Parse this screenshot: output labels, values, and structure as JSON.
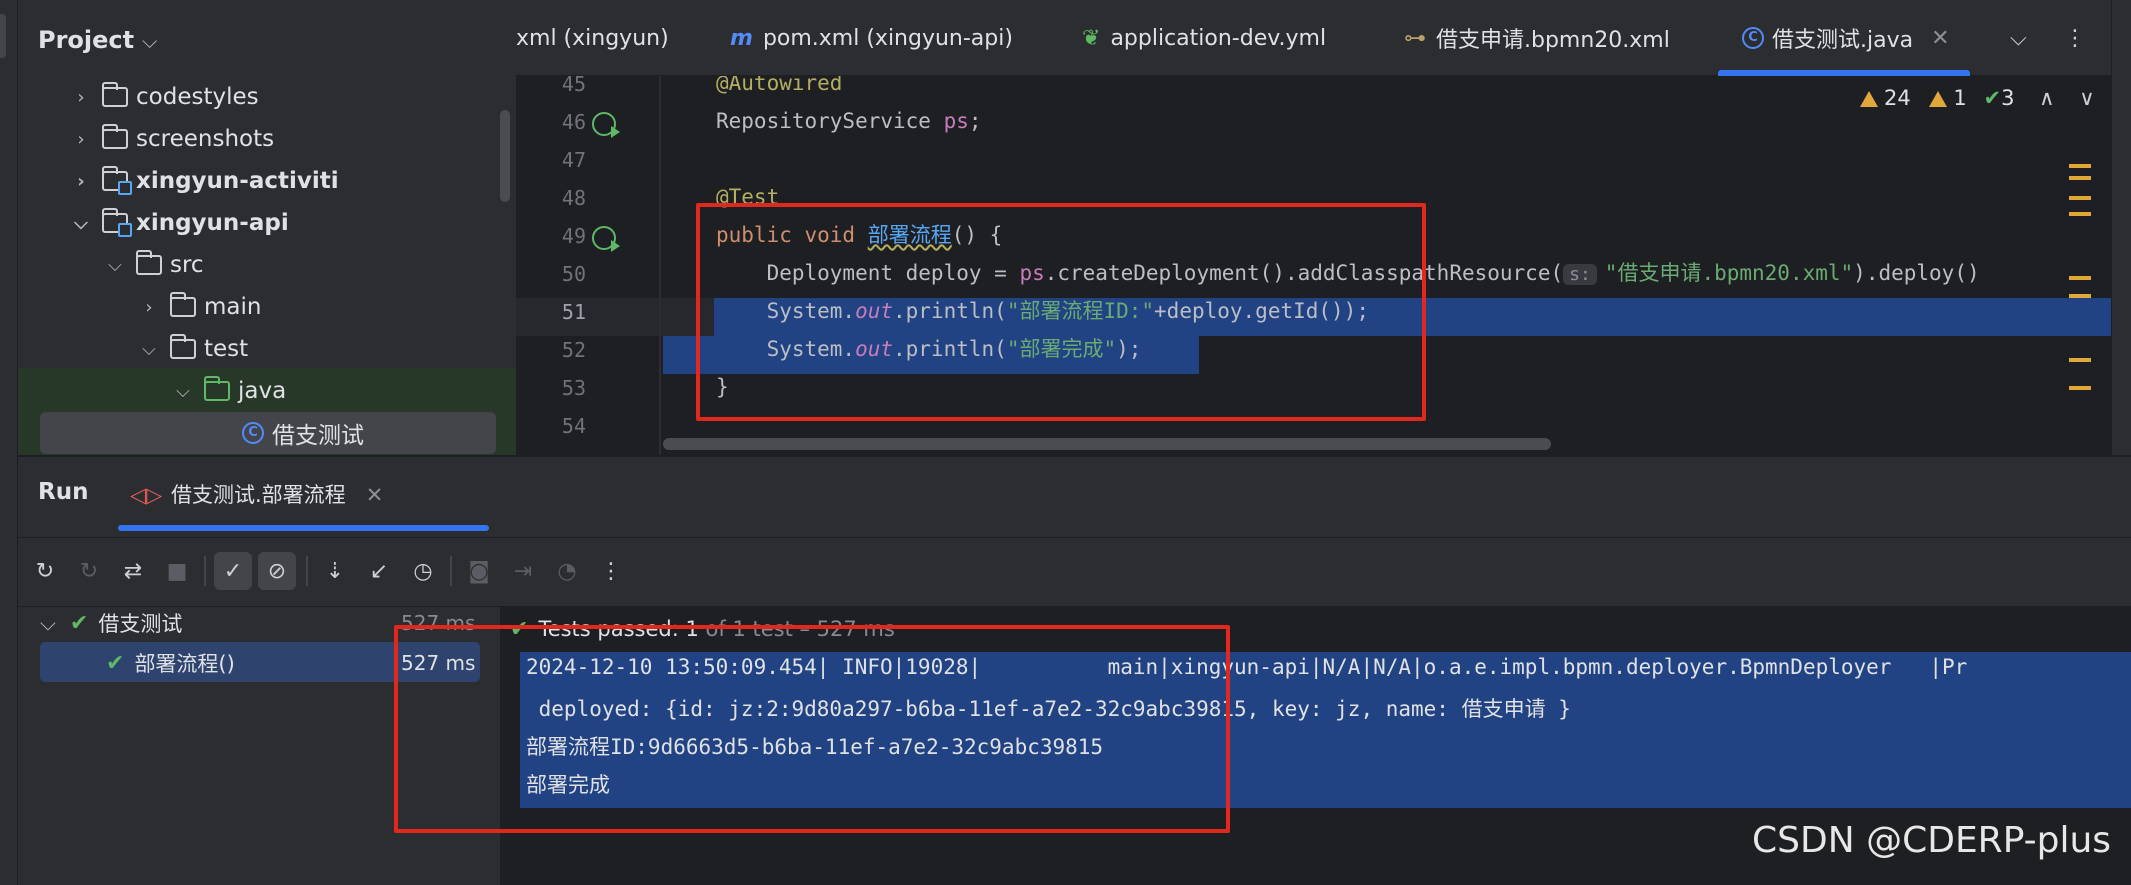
{
  "project": {
    "title": "Project",
    "tree": [
      {
        "label": "codestyles"
      },
      {
        "label": "screenshots"
      },
      {
        "label": "xingyun-activiti"
      },
      {
        "label": "xingyun-api"
      },
      {
        "label": "src"
      },
      {
        "label": "main"
      },
      {
        "label": "test"
      },
      {
        "label": "java"
      },
      {
        "label": "借支测试"
      }
    ]
  },
  "editor_tabs": [
    {
      "label": "xml (xingyun)"
    },
    {
      "label": "pom.xml (xingyun-api)",
      "icon": "m"
    },
    {
      "label": "application-dev.yml"
    },
    {
      "label": "借支申请.bpmn20.xml"
    },
    {
      "label": "借支测试.java",
      "active": true
    }
  ],
  "inspections": {
    "warnings": "24",
    "weak_warnings": "1",
    "typos": "3"
  },
  "code": {
    "lines": [
      "45",
      "46",
      "47",
      "48",
      "49",
      "50",
      "51",
      "52",
      "53",
      "54"
    ],
    "l45": "@Autowired",
    "l46_type": "RepositoryService ",
    "l46_var": "ps",
    "l48": "@Test",
    "l49_kw": "public void ",
    "l49_name": "部署流程",
    "l49_rest": "() {",
    "l50_a": "    Deployment deploy = ",
    "l50_ps": "ps",
    "l50_b": ".createDeployment().addClasspathResource(",
    "l50_hint": "s:",
    "l50_str": "\"借支申请.bpmn20.xml\"",
    "l50_c": ").deploy()",
    "l51_a": "    System.",
    "l51_out": "out",
    "l51_b": ".println(",
    "l51_str": "\"部署流程ID:\"",
    "l51_c": "+deploy.getId());",
    "l52_a": "    System.",
    "l52_out": "out",
    "l52_b": ".println(",
    "l52_str": "\"部署完成\"",
    "l52_c": ");",
    "l53": "}"
  },
  "run": {
    "title": "Run",
    "tab": "借支测试.部署流程",
    "tree": [
      {
        "label": "借支测试",
        "time": "527 ms"
      },
      {
        "label": "部署流程()",
        "time": "527 ms"
      }
    ],
    "tests_passed": "Tests passed: 1",
    "tests_detail": " of 1 test – 527 ms",
    "console": [
      "2024-12-10 13:50:09.454| INFO|19028|          main|xingyun-api|N/A|N/A|o.a.e.impl.bpmn.deployer.BpmnDeployer   |Pr",
      " deployed: {id: jz:2:9d80a297-b6ba-11ef-a7e2-32c9abc39815, key: jz, name: 借支申请 }",
      "部署流程ID:9d6663d5-b6ba-11ef-a7e2-32c9abc39815",
      "部署完成"
    ]
  },
  "watermark": "CSDN @CDERP-plus"
}
